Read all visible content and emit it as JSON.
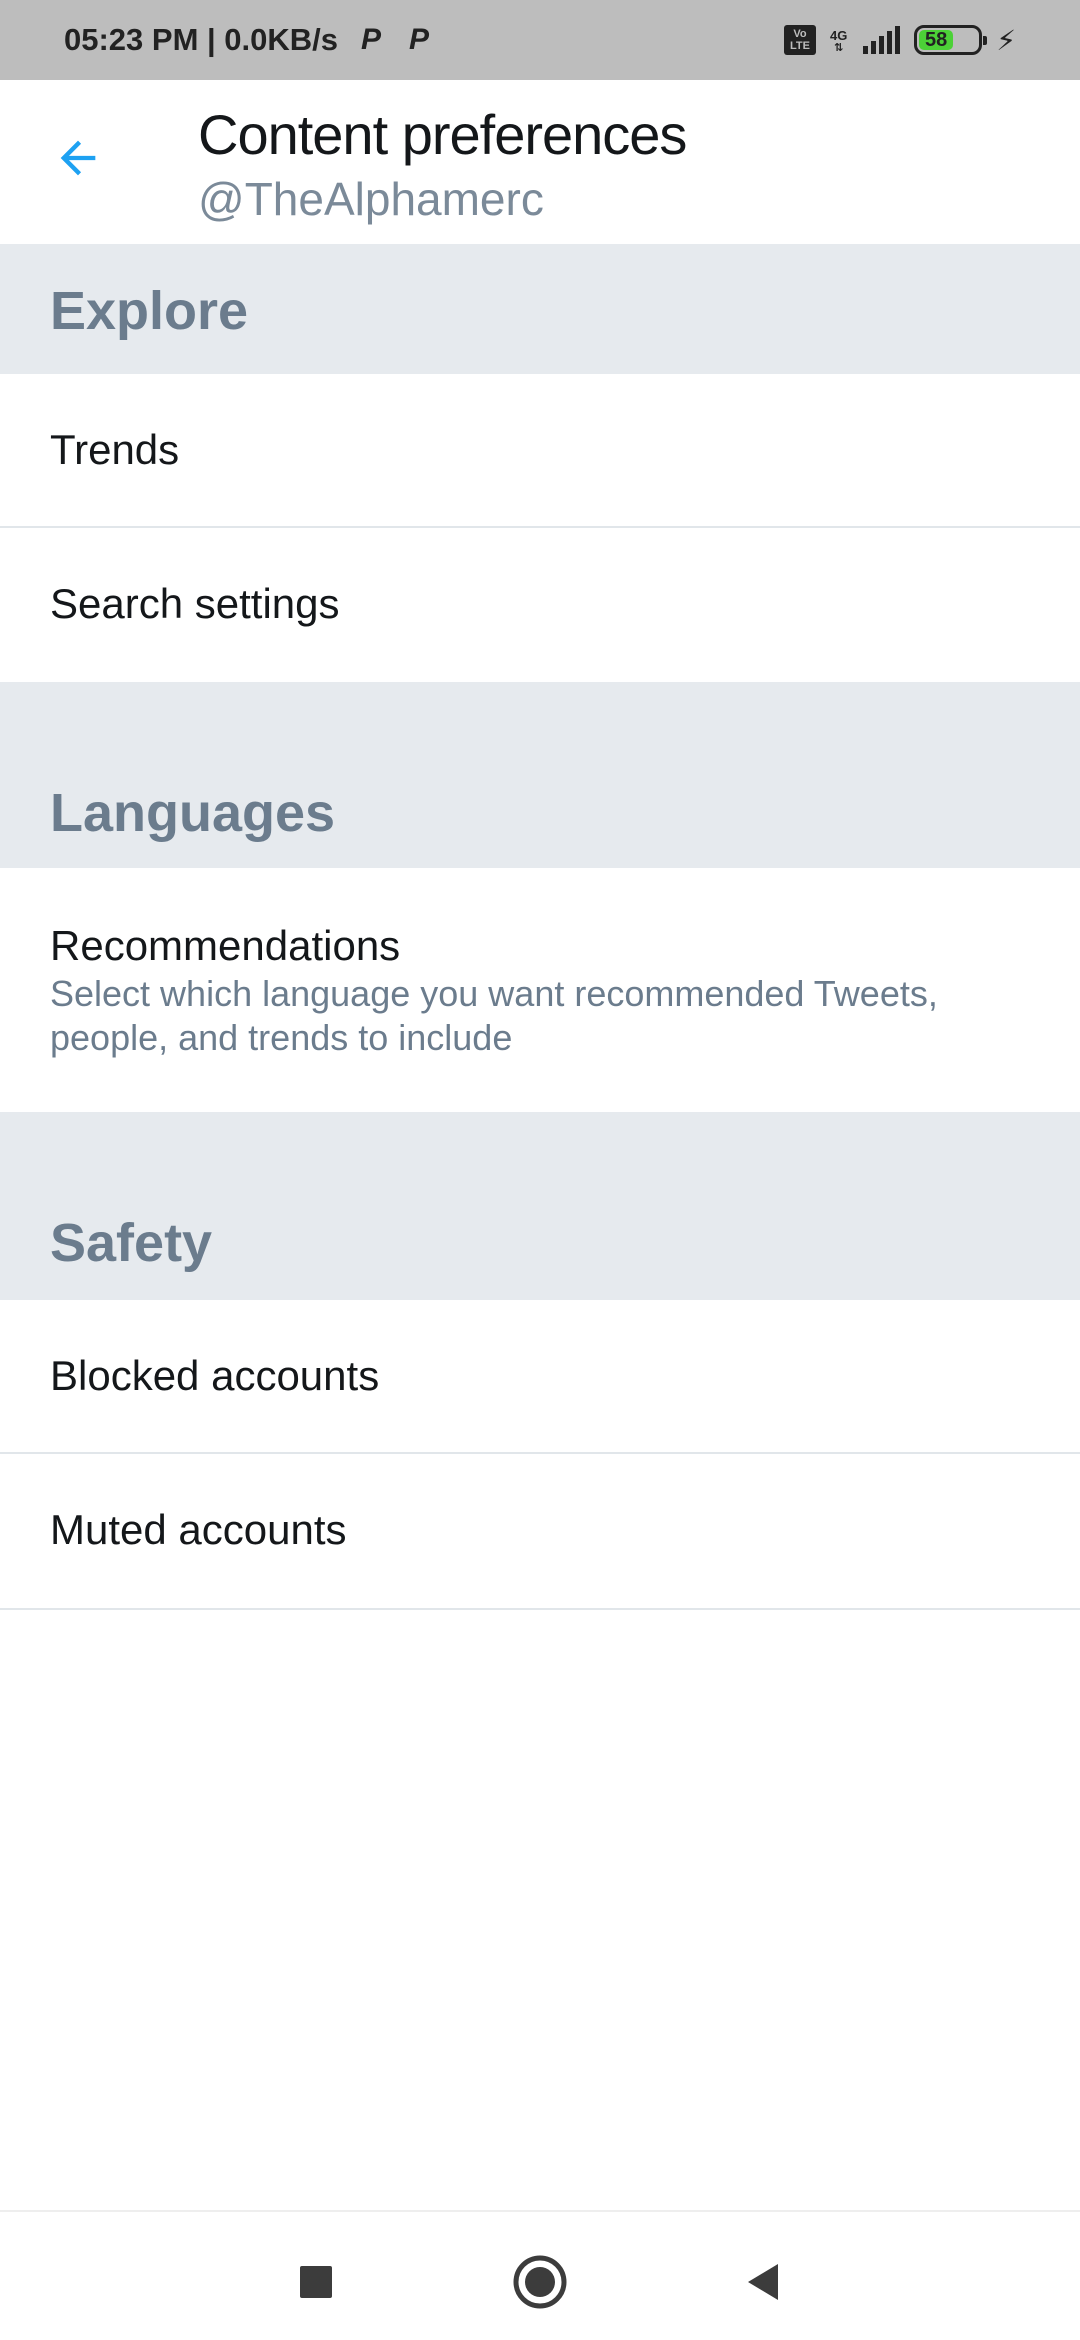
{
  "status_bar": {
    "time_speed": "05:23 PM | 0.0KB/s",
    "p_icon_1": "P",
    "p_icon_2": "P",
    "volte": "Vo\nLTE",
    "network": "4G",
    "battery_level": "58",
    "battery_fraction": 0.58
  },
  "header": {
    "title": "Content preferences",
    "subtitle": "@TheAlphamerc"
  },
  "sections": {
    "explore": {
      "title": "Explore",
      "items": [
        {
          "label": "Trends"
        },
        {
          "label": "Search settings"
        }
      ]
    },
    "languages": {
      "title": "Languages",
      "items": [
        {
          "label": "Recommendations",
          "description": "Select which language you want recommended Tweets, people, and trends to include"
        }
      ]
    },
    "safety": {
      "title": "Safety",
      "items": [
        {
          "label": "Blocked accounts"
        },
        {
          "label": "Muted accounts"
        }
      ]
    }
  },
  "colors": {
    "accent": "#1da1f2",
    "section_bg": "#e6eaee",
    "section_text": "#6b7c8d",
    "primary_text": "#14171a",
    "secondary_text": "#7b8a99"
  },
  "nav": {
    "recents_icon": "square-icon",
    "home_icon": "circle-icon",
    "back_icon": "triangle-back-icon"
  }
}
